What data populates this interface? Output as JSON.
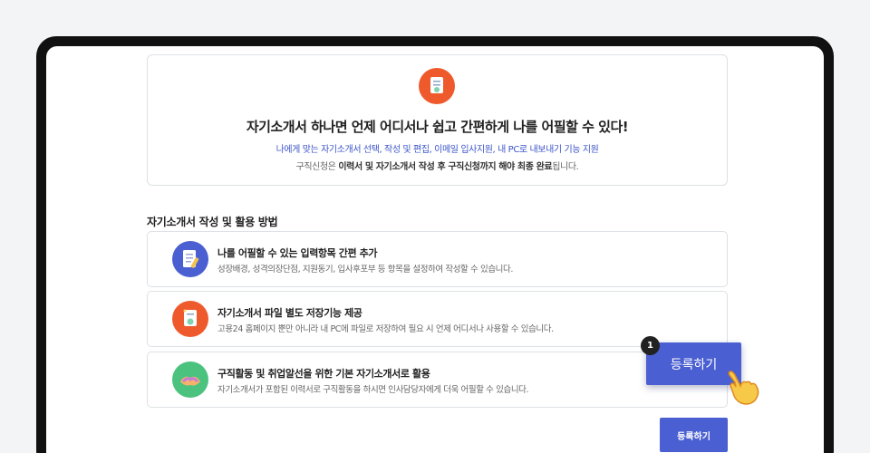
{
  "intro": {
    "title": "자기소개서 하나면 언제 어디서나 쉽고 간편하게 나를 어필할 수 있다!",
    "feature_text": "나에게 맞는 자기소개서 선택, 작성 및 편집, 이메일 입사지원, 내 PC로 내보내기 기능 지원",
    "note_prefix": "구직신청은 ",
    "note_bold": "이력서 및 자기소개서 작성 후 구직신청까지 해야 최종 완료",
    "note_suffix": "됩니다.",
    "icon": "document-icon"
  },
  "section": {
    "title": "자기소개서 작성 및 활용 방법"
  },
  "items": [
    {
      "title": "나를 어필할 수 있는 입력항목 간편 추가",
      "desc": "성장배경, 성격의장단점, 지원동기, 입사후포부 등 항목을 설정하여 작성할 수 있습니다.",
      "icon": "edit-document-icon",
      "color": "#4a5fd1"
    },
    {
      "title": "자기소개서 파일 별도 저장기능 제공",
      "desc": "고용24 홈페이지 뿐만 아니라 내 PC에 파일로 저장하여 필요 시 언제 어디서나 사용할 수 있습니다.",
      "icon": "save-document-icon",
      "color": "#ee5a2c"
    },
    {
      "title": "구직활동 및 취업알선을 위한 기본 자기소개서로 활용",
      "desc": "자기소개서가 포함된 이력서로 구직활동을 하시면 인사담당자에게 더욱 어필할 수 있습니다.",
      "icon": "handshake-icon",
      "color": "#4cc27f"
    }
  ],
  "tutorial": {
    "step": "1",
    "button_label": "등록하기",
    "pointer_icon": "pointing-hand-icon"
  },
  "actions": {
    "register_label": "등록하기"
  },
  "colors": {
    "accent": "#4a5fd1",
    "orange": "#ee5a2c",
    "green": "#4cc27f"
  }
}
